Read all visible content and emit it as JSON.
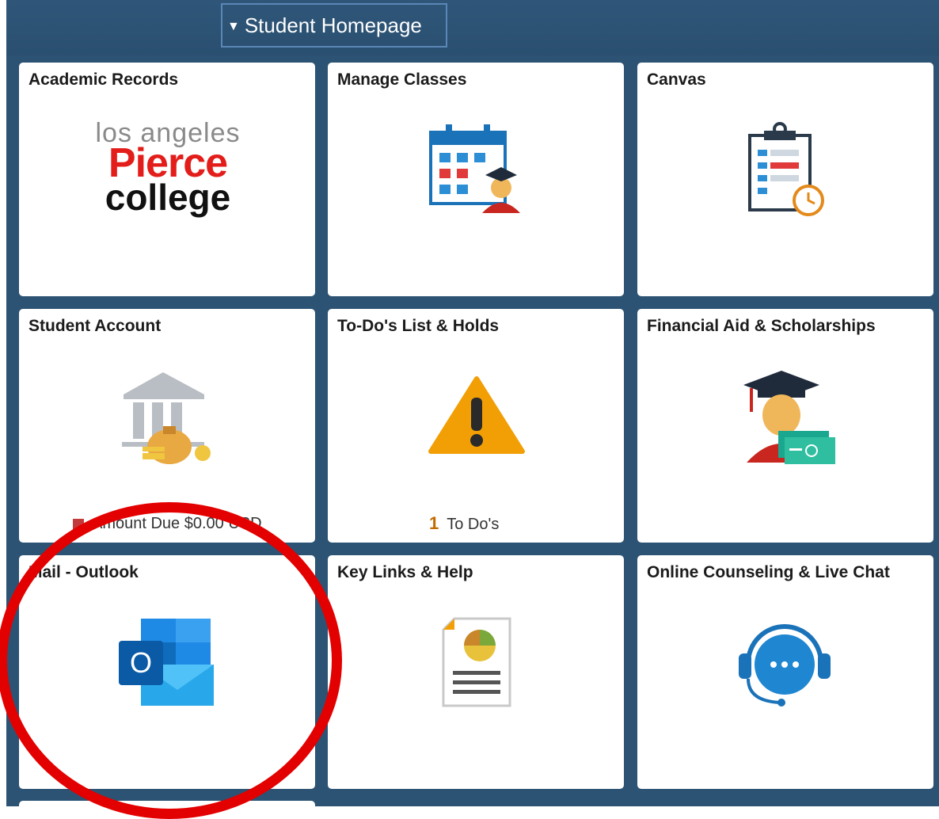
{
  "header": {
    "title": "Student Homepage"
  },
  "tiles": [
    {
      "title": "Academic Records",
      "logo": {
        "line1": "los angeles",
        "line2": "Pierce",
        "line3": "college"
      }
    },
    {
      "title": "Manage Classes"
    },
    {
      "title": "Canvas"
    },
    {
      "title": "Student Account",
      "footer": "Amount Due $0.00 USD"
    },
    {
      "title": "To-Do's List & Holds",
      "footer_count": "1",
      "footer_label": "To Do's"
    },
    {
      "title": "Financial Aid & Scholarships"
    },
    {
      "title": "Mail - Outlook",
      "icon_letter": "O"
    },
    {
      "title": "Key Links & Help"
    },
    {
      "title": "Online Counseling & Live Chat"
    }
  ],
  "colors": {
    "header_bg": "#2f5679",
    "accent_red": "#e30000",
    "tile_bg": "#ffffff"
  }
}
